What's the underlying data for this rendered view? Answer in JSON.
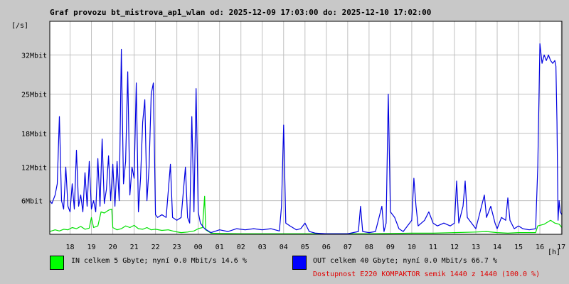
{
  "title": "Graf provozu bt_mistrova_ap1_wlan od: 2025-12-09 17:03:00 do: 2025-12-10 17:02:00",
  "chart_data": {
    "type": "line",
    "ylabel": "[/s]",
    "xlabel": "[h]",
    "ylim": [
      0,
      38
    ],
    "y_ticks": [
      {
        "value": 6,
        "label": "6Mbit"
      },
      {
        "value": 12,
        "label": "12Mbit"
      },
      {
        "value": 18,
        "label": "18Mbit"
      },
      {
        "value": 25,
        "label": "25Mbit"
      },
      {
        "value": 32,
        "label": "32Mbit"
      }
    ],
    "xlim": [
      17.05,
      41.03
    ],
    "x_ticks": [
      {
        "value": 18,
        "label": "18"
      },
      {
        "value": 19,
        "label": "19"
      },
      {
        "value": 20,
        "label": "20"
      },
      {
        "value": 21,
        "label": "21"
      },
      {
        "value": 22,
        "label": "22"
      },
      {
        "value": 23,
        "label": "23"
      },
      {
        "value": 24,
        "label": "00"
      },
      {
        "value": 25,
        "label": "01"
      },
      {
        "value": 26,
        "label": "02"
      },
      {
        "value": 27,
        "label": "03"
      },
      {
        "value": 28,
        "label": "04"
      },
      {
        "value": 29,
        "label": "05"
      },
      {
        "value": 30,
        "label": "06"
      },
      {
        "value": 31,
        "label": "07"
      },
      {
        "value": 32,
        "label": "08"
      },
      {
        "value": 33,
        "label": "09"
      },
      {
        "value": 34,
        "label": "10"
      },
      {
        "value": 35,
        "label": "11"
      },
      {
        "value": 36,
        "label": "12"
      },
      {
        "value": 37,
        "label": "13"
      },
      {
        "value": 38,
        "label": "14"
      },
      {
        "value": 39,
        "label": "15"
      },
      {
        "value": 40,
        "label": "16"
      },
      {
        "value": 41,
        "label": "17"
      }
    ],
    "grid": true,
    "series": [
      {
        "name": "IN",
        "color": "#00e000",
        "points": [
          [
            17.05,
            0.5
          ],
          [
            17.3,
            0.8
          ],
          [
            17.5,
            0.6
          ],
          [
            17.7,
            0.9
          ],
          [
            17.9,
            0.8
          ],
          [
            18.1,
            1.2
          ],
          [
            18.3,
            1.0
          ],
          [
            18.5,
            1.4
          ],
          [
            18.7,
            0.9
          ],
          [
            18.9,
            1.1
          ],
          [
            19.0,
            3.0
          ],
          [
            19.1,
            1.2
          ],
          [
            19.3,
            1.5
          ],
          [
            19.45,
            4.0
          ],
          [
            19.6,
            3.8
          ],
          [
            19.8,
            4.3
          ],
          [
            19.95,
            4.5
          ],
          [
            20.0,
            1.2
          ],
          [
            20.2,
            0.8
          ],
          [
            20.4,
            1.0
          ],
          [
            20.6,
            1.5
          ],
          [
            20.8,
            1.2
          ],
          [
            21.0,
            1.6
          ],
          [
            21.2,
            1.0
          ],
          [
            21.4,
            0.9
          ],
          [
            21.6,
            1.2
          ],
          [
            21.8,
            0.8
          ],
          [
            22.0,
            0.9
          ],
          [
            22.3,
            0.7
          ],
          [
            22.6,
            0.8
          ],
          [
            22.9,
            0.5
          ],
          [
            23.2,
            0.3
          ],
          [
            23.5,
            0.4
          ],
          [
            23.8,
            0.6
          ],
          [
            24.0,
            1.0
          ],
          [
            24.2,
            1.2
          ],
          [
            24.3,
            6.8
          ],
          [
            24.35,
            0.8
          ],
          [
            24.6,
            0.2
          ],
          [
            25.0,
            0.15
          ],
          [
            26.0,
            0.1
          ],
          [
            27.0,
            0.1
          ],
          [
            28.0,
            0.1
          ],
          [
            29.0,
            0.1
          ],
          [
            30.0,
            0.1
          ],
          [
            31.0,
            0.1
          ],
          [
            32.0,
            0.1
          ],
          [
            33.0,
            0.15
          ],
          [
            34.0,
            0.2
          ],
          [
            35.0,
            0.2
          ],
          [
            36.0,
            0.3
          ],
          [
            37.0,
            0.4
          ],
          [
            37.5,
            0.5
          ],
          [
            38.0,
            0.3
          ],
          [
            38.5,
            0.2
          ],
          [
            39.0,
            0.3
          ],
          [
            39.5,
            0.3
          ],
          [
            39.8,
            0.3
          ],
          [
            39.9,
            1.5
          ],
          [
            40.2,
            1.8
          ],
          [
            40.5,
            2.5
          ],
          [
            40.7,
            2.0
          ],
          [
            40.9,
            1.8
          ],
          [
            41.03,
            1.2
          ]
        ]
      },
      {
        "name": "OUT",
        "color": "#0000e0",
        "points": [
          [
            17.05,
            6.0
          ],
          [
            17.15,
            5.5
          ],
          [
            17.3,
            7.0
          ],
          [
            17.4,
            9.0
          ],
          [
            17.5,
            21.0
          ],
          [
            17.6,
            6.0
          ],
          [
            17.7,
            4.5
          ],
          [
            17.8,
            12.0
          ],
          [
            17.9,
            5.0
          ],
          [
            18.0,
            4.0
          ],
          [
            18.1,
            9.0
          ],
          [
            18.2,
            4.5
          ],
          [
            18.3,
            15.0
          ],
          [
            18.4,
            5.0
          ],
          [
            18.5,
            7.0
          ],
          [
            18.6,
            4.0
          ],
          [
            18.7,
            11.0
          ],
          [
            18.8,
            5.0
          ],
          [
            18.9,
            13.0
          ],
          [
            19.0,
            4.5
          ],
          [
            19.1,
            6.0
          ],
          [
            19.2,
            4.0
          ],
          [
            19.3,
            13.5
          ],
          [
            19.4,
            5.0
          ],
          [
            19.5,
            17.0
          ],
          [
            19.6,
            5.5
          ],
          [
            19.7,
            8.0
          ],
          [
            19.8,
            14.0
          ],
          [
            19.9,
            6.0
          ],
          [
            20.0,
            12.5
          ],
          [
            20.1,
            5.0
          ],
          [
            20.2,
            13.0
          ],
          [
            20.3,
            6.0
          ],
          [
            20.4,
            33.0
          ],
          [
            20.5,
            9.0
          ],
          [
            20.6,
            13.0
          ],
          [
            20.7,
            29.0
          ],
          [
            20.8,
            7.0
          ],
          [
            20.9,
            12.0
          ],
          [
            21.0,
            10.0
          ],
          [
            21.1,
            27.0
          ],
          [
            21.2,
            4.0
          ],
          [
            21.3,
            10.0
          ],
          [
            21.4,
            20.0
          ],
          [
            21.5,
            24.0
          ],
          [
            21.6,
            6.0
          ],
          [
            21.7,
            12.0
          ],
          [
            21.8,
            25.0
          ],
          [
            21.9,
            27.0
          ],
          [
            22.0,
            3.5
          ],
          [
            22.1,
            3.0
          ],
          [
            22.3,
            3.5
          ],
          [
            22.5,
            3.0
          ],
          [
            22.7,
            12.5
          ],
          [
            22.8,
            3.0
          ],
          [
            23.0,
            2.5
          ],
          [
            23.2,
            3.0
          ],
          [
            23.4,
            12.0
          ],
          [
            23.5,
            3.0
          ],
          [
            23.6,
            2.0
          ],
          [
            23.7,
            21.0
          ],
          [
            23.8,
            4.0
          ],
          [
            23.9,
            26.0
          ],
          [
            24.0,
            4.0
          ],
          [
            24.1,
            2.0
          ],
          [
            24.3,
            1.0
          ],
          [
            24.6,
            0.3
          ],
          [
            25.0,
            0.8
          ],
          [
            25.4,
            0.5
          ],
          [
            25.8,
            1.0
          ],
          [
            26.2,
            0.8
          ],
          [
            26.6,
            1.0
          ],
          [
            27.0,
            0.8
          ],
          [
            27.4,
            1.0
          ],
          [
            27.8,
            0.6
          ],
          [
            27.9,
            5.0
          ],
          [
            28.0,
            19.5
          ],
          [
            28.1,
            2.0
          ],
          [
            28.3,
            1.5
          ],
          [
            28.6,
            0.8
          ],
          [
            28.8,
            1.0
          ],
          [
            29.0,
            2.0
          ],
          [
            29.2,
            0.5
          ],
          [
            29.5,
            0.2
          ],
          [
            30.0,
            0.1
          ],
          [
            30.5,
            0.1
          ],
          [
            31.0,
            0.1
          ],
          [
            31.5,
            0.5
          ],
          [
            31.6,
            5.0
          ],
          [
            31.7,
            0.5
          ],
          [
            32.0,
            0.3
          ],
          [
            32.3,
            0.5
          ],
          [
            32.5,
            3.5
          ],
          [
            32.6,
            5.0
          ],
          [
            32.7,
            0.5
          ],
          [
            32.8,
            2.0
          ],
          [
            32.9,
            25.0
          ],
          [
            33.0,
            4.0
          ],
          [
            33.2,
            3.0
          ],
          [
            33.4,
            1.0
          ],
          [
            33.6,
            0.5
          ],
          [
            34.0,
            2.5
          ],
          [
            34.1,
            10.0
          ],
          [
            34.2,
            5.0
          ],
          [
            34.3,
            1.5
          ],
          [
            34.6,
            2.5
          ],
          [
            34.8,
            4.0
          ],
          [
            35.0,
            2.0
          ],
          [
            35.2,
            1.5
          ],
          [
            35.5,
            2.0
          ],
          [
            35.8,
            1.5
          ],
          [
            36.0,
            2.0
          ],
          [
            36.1,
            9.5
          ],
          [
            36.2,
            2.0
          ],
          [
            36.4,
            5.0
          ],
          [
            36.5,
            9.5
          ],
          [
            36.6,
            3.0
          ],
          [
            36.8,
            2.0
          ],
          [
            37.0,
            1.0
          ],
          [
            37.2,
            4.0
          ],
          [
            37.4,
            7.0
          ],
          [
            37.5,
            3.0
          ],
          [
            37.7,
            5.0
          ],
          [
            37.9,
            2.0
          ],
          [
            38.0,
            1.0
          ],
          [
            38.2,
            3.0
          ],
          [
            38.4,
            2.5
          ],
          [
            38.5,
            6.5
          ],
          [
            38.6,
            2.5
          ],
          [
            38.8,
            1.0
          ],
          [
            39.0,
            1.5
          ],
          [
            39.2,
            1.0
          ],
          [
            39.5,
            0.8
          ],
          [
            39.8,
            1.0
          ],
          [
            39.9,
            12.0
          ],
          [
            40.0,
            34.0
          ],
          [
            40.1,
            30.5
          ],
          [
            40.2,
            32.0
          ],
          [
            40.3,
            31.0
          ],
          [
            40.4,
            32.0
          ],
          [
            40.5,
            31.0
          ],
          [
            40.6,
            30.5
          ],
          [
            40.7,
            31.0
          ],
          [
            40.75,
            30.0
          ],
          [
            40.8,
            20.0
          ],
          [
            40.85,
            2.5
          ],
          [
            40.9,
            6.0
          ],
          [
            40.95,
            4.0
          ],
          [
            41.03,
            3.5
          ]
        ]
      }
    ]
  },
  "legend": {
    "in": {
      "text": "IN celkem 5 Gbyte; nyní   0.0 Mbit/s 14.6 %",
      "color": "#00ff00"
    },
    "out": {
      "text": "OUT celkem 40 Gbyte; nyní   0.0 Mbit/s 66.7 %",
      "color": "#0000ff"
    },
    "availability": "Dostupnost E220 KOMPAKTOR semik 1440 z 1440 (100.0 %)"
  }
}
